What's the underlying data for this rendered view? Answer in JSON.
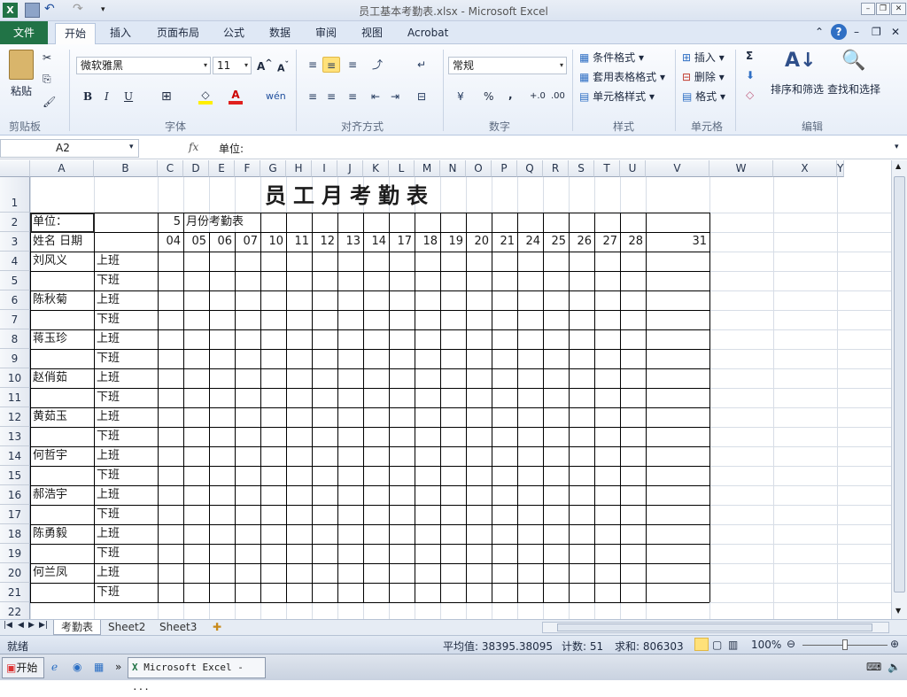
{
  "window": {
    "title": "员工基本考勤表.xlsx - Microsoft Excel"
  },
  "ribbon_tabs": [
    "文件",
    "开始",
    "插入",
    "页面布局",
    "公式",
    "数据",
    "审阅",
    "视图",
    "Acrobat"
  ],
  "clipboard": {
    "paste_label": "粘贴",
    "group": "剪贴板"
  },
  "font": {
    "name": "微软雅黑",
    "size": "11",
    "group": "字体",
    "bold": "B",
    "italic": "I",
    "underline": "U"
  },
  "alignment": {
    "group": "对齐方式"
  },
  "number": {
    "format": "常规",
    "group": "数字",
    "percent": "%",
    "comma": ","
  },
  "styles": {
    "conditional": "条件格式",
    "table": "套用表格格式",
    "cell": "单元格样式",
    "group": "样式"
  },
  "cells_group": {
    "insert": "插入",
    "delete": "删除",
    "format": "格式",
    "group": "单元格"
  },
  "editing": {
    "sort": "排序和筛选",
    "find": "查找和选择",
    "group": "编辑",
    "sum": "Σ"
  },
  "formula_bar": {
    "name_box": "A2",
    "fx": "fx",
    "value": "单位:"
  },
  "columns": [
    "A",
    "B",
    "C",
    "D",
    "E",
    "F",
    "G",
    "H",
    "I",
    "J",
    "K",
    "L",
    "M",
    "N",
    "O",
    "P",
    "Q",
    "R",
    "S",
    "T",
    "U",
    "V",
    "W",
    "X",
    "Y"
  ],
  "rows": [
    "1",
    "2",
    "3",
    "4",
    "5",
    "6",
    "7",
    "8",
    "9",
    "10",
    "11",
    "12",
    "13",
    "14",
    "15",
    "16",
    "17",
    "18",
    "19",
    "20",
    "21",
    "22"
  ],
  "sheet": {
    "title": "员工月考勤表",
    "unit_label": "单位：",
    "month": "5",
    "month_label": "月份考勤表",
    "name_header": "姓名 日期",
    "dates": [
      "04",
      "05",
      "06",
      "07",
      "10",
      "11",
      "12",
      "13",
      "14",
      "17",
      "18",
      "19",
      "20",
      "21",
      "24",
      "25",
      "26",
      "27",
      "28",
      "31"
    ],
    "shift_on": "上班",
    "shift_off": "下班",
    "employees": [
      "刘风义",
      "陈秋菊",
      "蒋玉珍",
      "赵俏茹",
      "黄茹玉",
      "何哲宇",
      "郝浩宇",
      "陈勇毅",
      "何兰凤"
    ]
  },
  "sheet_tabs": [
    "考勤表",
    "Sheet2",
    "Sheet3"
  ],
  "status": {
    "ready": "就绪",
    "average": "平均值: 38395.38095",
    "count": "计数: 51",
    "sum": "求和: 806303",
    "zoom": "100%"
  },
  "taskbar": {
    "start": "开始",
    "app": "Microsoft Excel - ..."
  }
}
